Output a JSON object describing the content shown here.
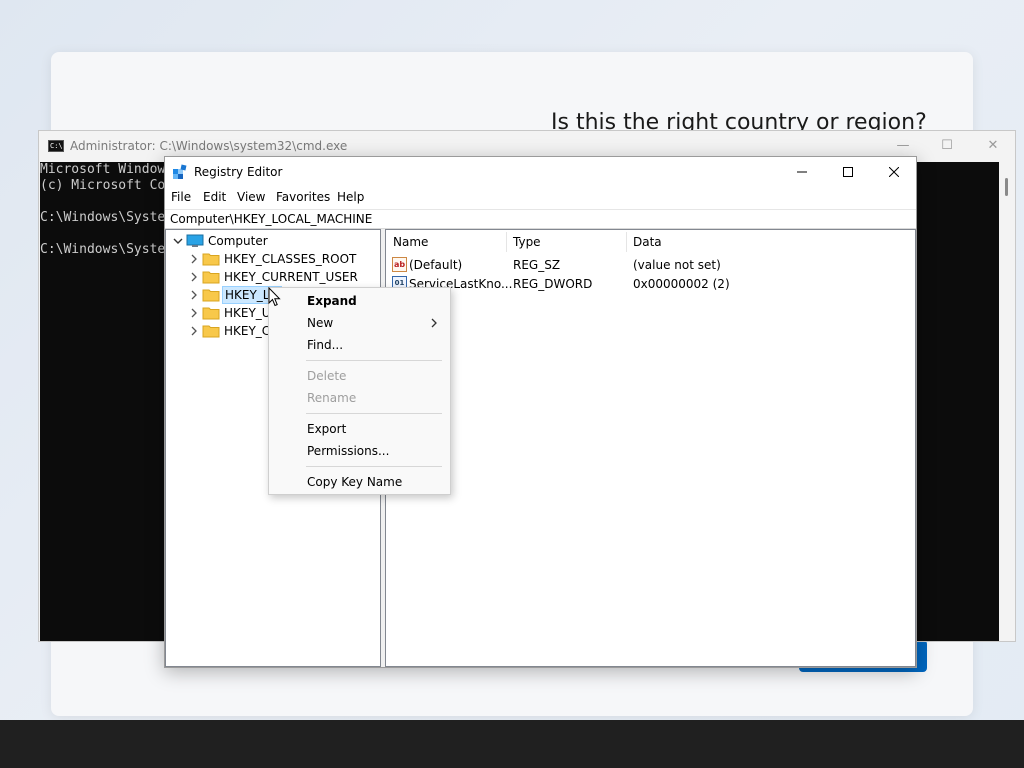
{
  "oobe": {
    "title": "Is this the right country or region?"
  },
  "cmd": {
    "title": "Administrator: C:\\Windows\\system32\\cmd.exe",
    "lines": [
      "Microsoft Window",
      "(c) Microsoft Co",
      "",
      "C:\\Windows\\Syste",
      "",
      "C:\\Windows\\Syste"
    ],
    "controls": {
      "minimize": "—",
      "maximize": "☐",
      "close": "✕"
    }
  },
  "regedit": {
    "title": "Registry Editor",
    "menu": [
      "File",
      "Edit",
      "View",
      "Favorites",
      "Help"
    ],
    "address": "Computer\\HKEY_LOCAL_MACHINE",
    "tree": {
      "root": "Computer",
      "items": [
        {
          "label": "HKEY_CLASSES_ROOT"
        },
        {
          "label": "HKEY_CURRENT_USER"
        },
        {
          "label": "HKEY_LO"
        },
        {
          "label": "HKEY_US"
        },
        {
          "label": "HKEY_CU"
        }
      ]
    },
    "columns": {
      "name": "Name",
      "type": "Type",
      "data": "Data"
    },
    "values": [
      {
        "icon": "string-value-icon",
        "name": "(Default)",
        "type": "REG_SZ",
        "data": "(value not set)"
      },
      {
        "icon": "dword-value-icon",
        "name": "ServiceLastKno...",
        "type": "REG_DWORD",
        "data": "0x00000002 (2)"
      }
    ]
  },
  "context_menu": {
    "expand": "Expand",
    "new": "New",
    "find": "Find...",
    "delete": "Delete",
    "rename": "Rename",
    "export": "Export",
    "permissions": "Permissions...",
    "copy_key_name": "Copy Key Name"
  },
  "colors": {
    "accent": "#0067c0",
    "selection": "#cce8ff",
    "cmd_background": "#0c0c0c",
    "taskbar": "#202020"
  }
}
